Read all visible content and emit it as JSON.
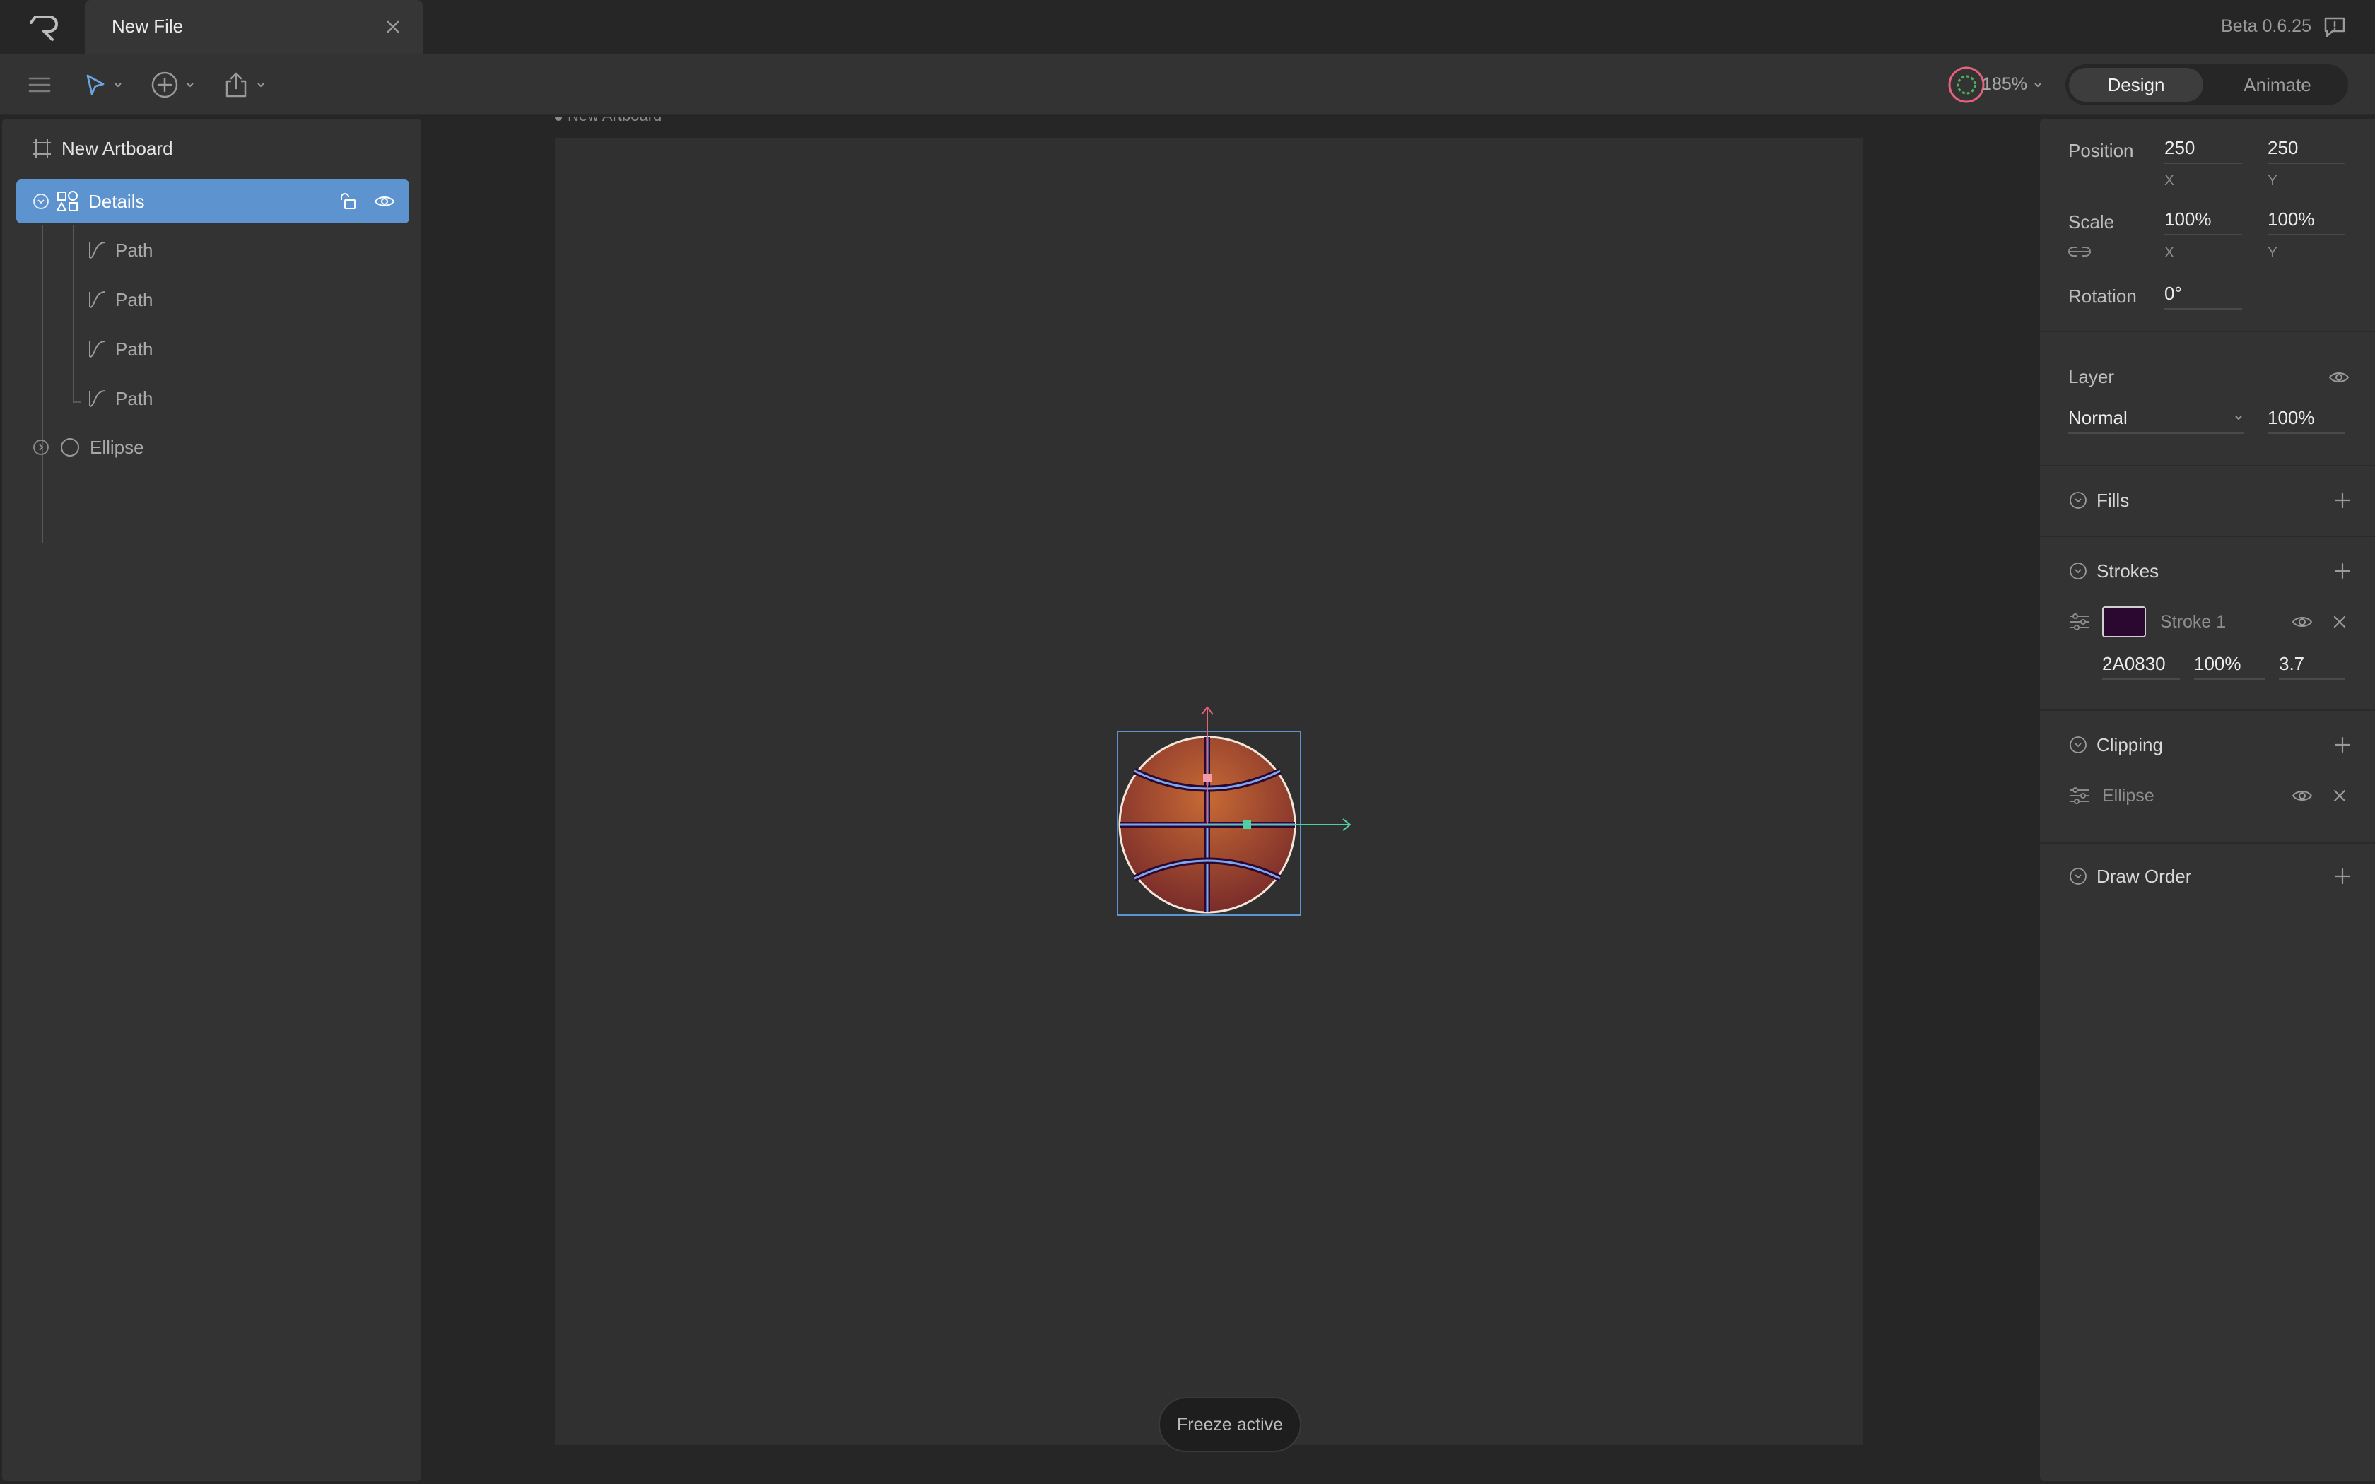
{
  "app": {
    "file_tab": "New File",
    "version": "Beta 0.6.25"
  },
  "toolbar": {
    "zoom": "185%",
    "modes": [
      "Design",
      "Animate"
    ],
    "active_mode": "Design"
  },
  "hierarchy": {
    "artboard": "New Artboard",
    "selected_group": "Details",
    "paths": [
      "Path",
      "Path",
      "Path",
      "Path"
    ],
    "ellipse": "Ellipse"
  },
  "canvas": {
    "artboard_label": "New Artboard",
    "status": "Freeze active"
  },
  "inspector": {
    "position": {
      "label": "Position",
      "x": "250",
      "y": "250",
      "x_axis": "X",
      "y_axis": "Y"
    },
    "scale": {
      "label": "Scale",
      "x": "100%",
      "y": "100%",
      "x_axis": "X",
      "y_axis": "Y"
    },
    "rotation": {
      "label": "Rotation",
      "value": "0°"
    },
    "layer": {
      "label": "Layer",
      "blend_mode": "Normal",
      "opacity": "100%"
    },
    "fills": {
      "label": "Fills"
    },
    "strokes": {
      "label": "Strokes",
      "stroke_name": "Stroke 1",
      "color_hex": "2A0830",
      "opacity": "100%",
      "width": "3.7",
      "swatch_color": "#2A0830"
    },
    "clipping": {
      "label": "Clipping",
      "shape": "Ellipse"
    },
    "draw_order": {
      "label": "Draw Order"
    }
  },
  "colors": {
    "accent": "#5d93cf",
    "ball_fill": "#b25a2e",
    "x_axis": "#4fd0a0",
    "y_axis": "#e2637c"
  }
}
